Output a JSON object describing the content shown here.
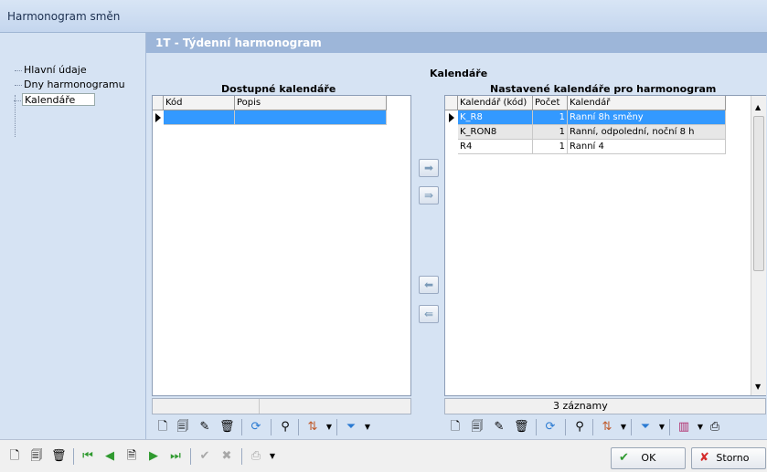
{
  "window": {
    "title": "Harmonogram směn"
  },
  "tree": {
    "items": [
      "Hlavní údaje",
      "Dny harmonogramu",
      "Kalendáře"
    ]
  },
  "section": {
    "title": "1T  -  Týdenní harmonogram"
  },
  "calendars_label": "Kalendáře",
  "available": {
    "title": "Dostupné kalendáře",
    "columns": [
      "Kód",
      "Popis"
    ]
  },
  "assigned": {
    "title": "Nastavené kalendáře pro harmonogram",
    "columns": [
      "Kalendář (kód)",
      "Počet",
      "Kalendář"
    ],
    "rows": [
      {
        "code": "K_R8",
        "count": "1",
        "name": "Ranní 8h směny"
      },
      {
        "code": "K_RON8",
        "count": "1",
        "name": "Ranní, odpolední, noční 8 h"
      },
      {
        "code": "R4",
        "count": "1",
        "name": "Ranní 4"
      }
    ],
    "record_count": "3 záznamy"
  },
  "buttons": {
    "ok": "OK",
    "cancel": "Storno"
  },
  "colors": {
    "selection": "#3399ff",
    "header": "#9db6d9",
    "panel": "#d6e3f3"
  }
}
